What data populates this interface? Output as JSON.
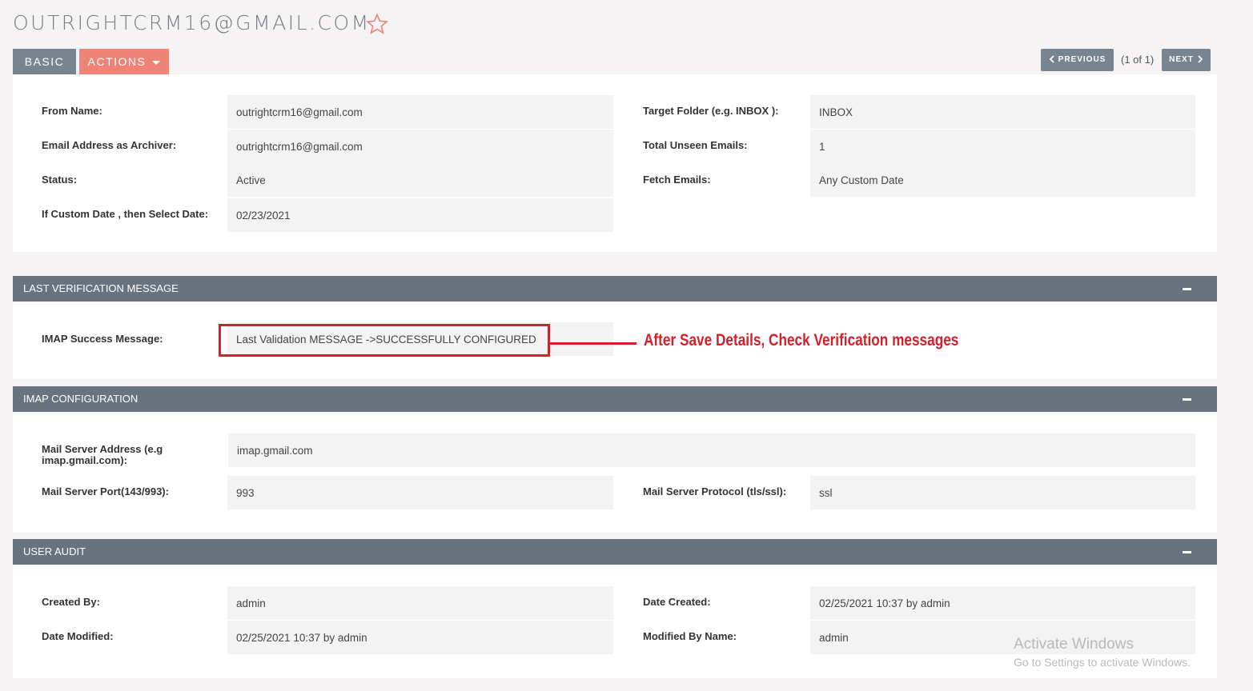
{
  "page": {
    "title": "OUTRIGHTCRM16@GMAIL.COM"
  },
  "tabs": {
    "basic": "BASIC",
    "actions": "ACTIONS"
  },
  "nav": {
    "previous": "PREVIOUS",
    "count": "(1 of 1)",
    "next": "NEXT"
  },
  "main": {
    "from_name_label": "From Name:",
    "from_name_value": "outrightcrm16@gmail.com",
    "archiver_label": "Email Address as Archiver:",
    "archiver_value": "outrightcrm16@gmail.com",
    "status_label": "Status:",
    "status_value": "Active",
    "custom_date_label": "If Custom Date , then Select Date:",
    "custom_date_value": "02/23/2021",
    "target_folder_label": "Target Folder (e.g. INBOX ):",
    "target_folder_value": "INBOX",
    "unseen_label": "Total Unseen Emails:",
    "unseen_value": "1",
    "fetch_label": "Fetch Emails:",
    "fetch_value": "Any Custom Date"
  },
  "verification": {
    "header": "LAST VERIFICATION MESSAGE",
    "imap_label": "IMAP Success Message:",
    "imap_value": "Last Validation MESSAGE ->SUCCESSFULLY CONFIGURED",
    "annotation": "After Save Details, Check Verification messages"
  },
  "imap": {
    "header": "IMAP CONFIGURATION",
    "server_label": "Mail Server Address (e.g imap.gmail.com):",
    "server_value": "imap.gmail.com",
    "port_label": "Mail Server Port(143/993):",
    "port_value": "993",
    "protocol_label": "Mail Server Protocol (tls/ssl):",
    "protocol_value": "ssl"
  },
  "audit": {
    "header": "USER AUDIT",
    "created_by_label": "Created By:",
    "created_by_value": "admin",
    "date_created_label": "Date Created:",
    "date_created_value": "02/25/2021 10:37 by admin",
    "date_modified_label": "Date Modified:",
    "date_modified_value": "02/25/2021 10:37 by admin",
    "modified_by_label": "Modified By Name:",
    "modified_by_value": "admin"
  },
  "watermark": {
    "line1": "Activate Windows",
    "line2": "Go to Settings to activate Windows."
  },
  "colors": {
    "header_bg": "#687380",
    "tab_basic": "#778591",
    "tab_actions": "#f08377",
    "annotation_red": "#d4202a"
  },
  "icons": {
    "favorite": "star-outline-icon",
    "prev": "chevron-left-icon",
    "next": "chevron-right-icon",
    "collapse": "minus-icon",
    "dropdown": "caret-down-icon"
  }
}
